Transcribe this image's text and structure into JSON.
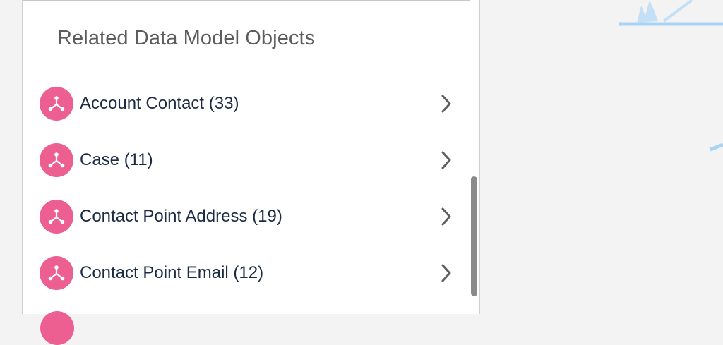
{
  "panel": {
    "title": "Related Data Model Objects",
    "items": [
      {
        "label": "Account Contact (33)",
        "icon": "data-model-object-icon"
      },
      {
        "label": "Case (11)",
        "icon": "data-model-object-icon"
      },
      {
        "label": "Contact Point Address (19)",
        "icon": "data-model-object-icon"
      },
      {
        "label": "Contact Point Email (12)",
        "icon": "data-model-object-icon"
      }
    ]
  },
  "colors": {
    "icon_background": "#ec5f90",
    "title_text": "#5c5c5c",
    "item_text": "#1c2b44",
    "chevron": "#5f5f5f",
    "scrollbar_thumb": "#8a8a8a",
    "page_background": "#f3f3f3",
    "decoration": "#a8d3f5"
  },
  "icons": {
    "item": "data-model-object-icon",
    "navigate": "chevron-right-icon"
  }
}
